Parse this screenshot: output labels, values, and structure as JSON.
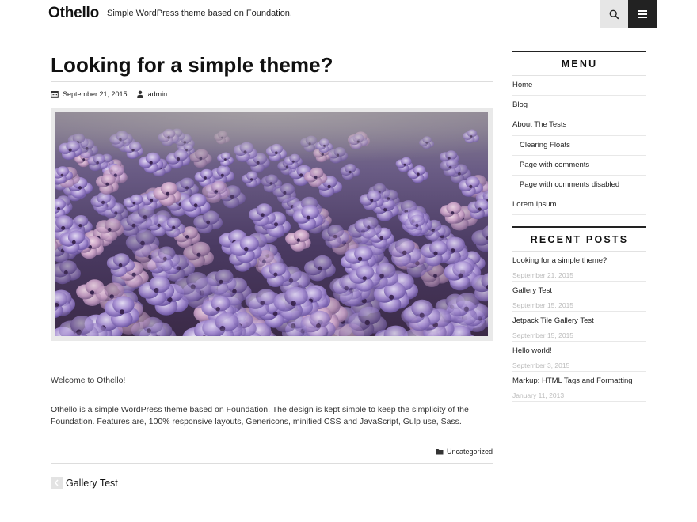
{
  "site": {
    "title": "Othello",
    "description": "Simple WordPress theme based on Foundation."
  },
  "post": {
    "title": "Looking for a simple theme?",
    "date": "September 21, 2015",
    "author": "admin",
    "paragraphs": [
      "Welcome to Othello!",
      "Othello is a simple WordPress theme based on Foundation. The design is kept simple to keep the simplicity of the Foundation. Features are, 100% responsive layouts, Genericons, minified CSS and JavaScript, Gulp use, Sass."
    ],
    "category": "Uncategorized"
  },
  "nav": {
    "previous": "Gallery Test"
  },
  "sidebar": {
    "menu_title": "MENU",
    "menu": [
      {
        "label": "Home",
        "sub": false
      },
      {
        "label": "Blog",
        "sub": false
      },
      {
        "label": "About The Tests",
        "sub": false
      },
      {
        "label": "Clearing Floats",
        "sub": true
      },
      {
        "label": "Page with comments",
        "sub": true
      },
      {
        "label": "Page with comments disabled",
        "sub": true
      },
      {
        "label": "Lorem Ipsum",
        "sub": false
      }
    ],
    "recent_title": "RECENT POSTS",
    "recent": [
      {
        "title": "Looking for a simple theme?",
        "date": "September 21, 2015"
      },
      {
        "title": "Gallery Test",
        "date": "September 15, 2015"
      },
      {
        "title": "Jetpack Tile Gallery Test",
        "date": "September 15, 2015"
      },
      {
        "title": "Hello world!",
        "date": "September 3, 2015"
      },
      {
        "title": "Markup: HTML Tags and Formatting",
        "date": "January 11, 2013"
      }
    ]
  },
  "icons": {
    "search": "search-icon",
    "menu": "menu-icon",
    "date": "calendar-icon",
    "author": "user-icon",
    "category": "folder-icon",
    "previous": "chevron-left-icon"
  },
  "colors": {
    "text": "#222222",
    "muted": "#bbbbbb",
    "menu_button": "#222222",
    "search_button": "#e6e6e6",
    "image_frame": "#e9e9e9"
  }
}
